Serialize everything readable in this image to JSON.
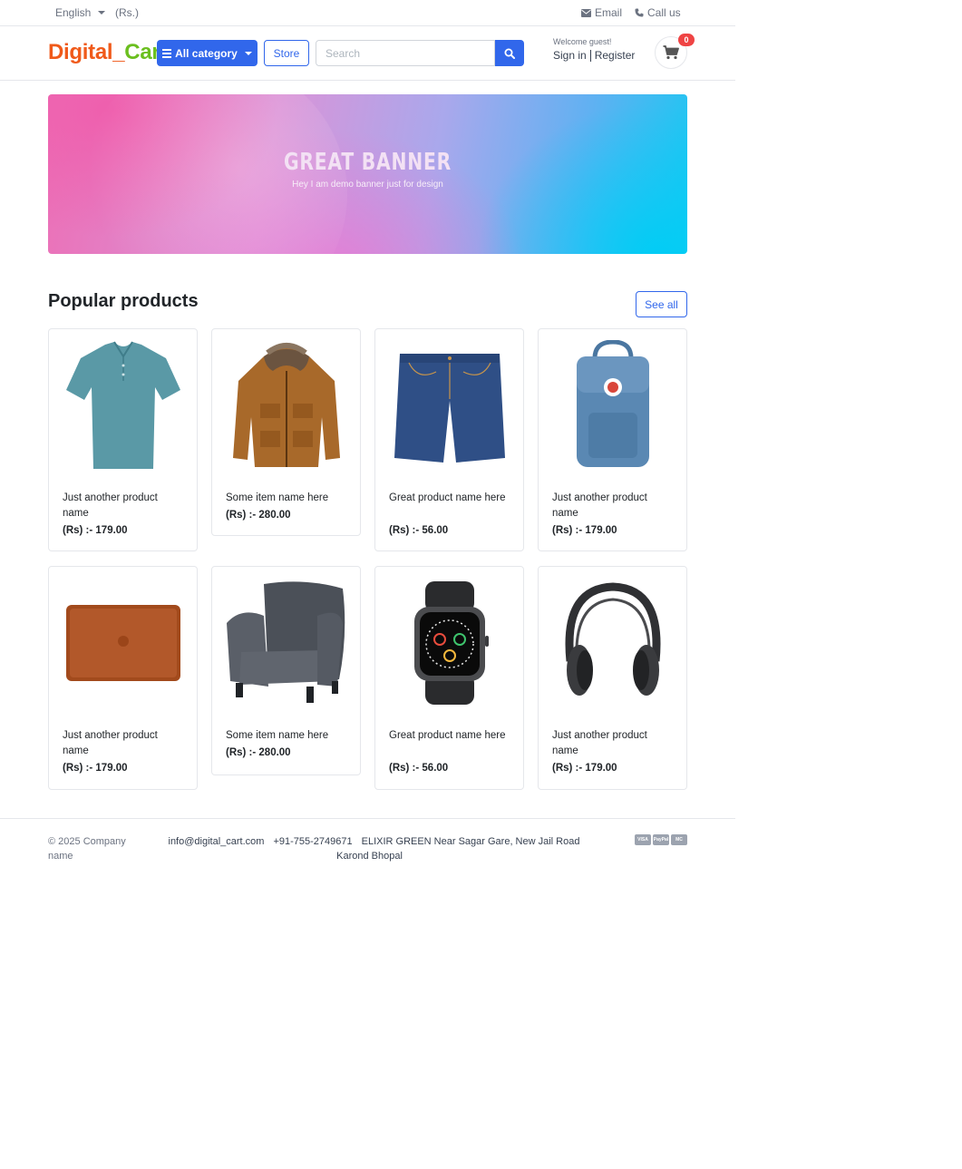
{
  "topbar": {
    "language": "English",
    "currency": "(Rs.)",
    "email_label": "Email",
    "call_label": "Call us"
  },
  "header": {
    "logo_part1": "Digital_",
    "logo_part2": "Cart",
    "category_button": "All category",
    "store_button": "Store",
    "search_placeholder": "Search",
    "welcome": "Welcome guest!",
    "sign_in": "Sign in",
    "register": "Register",
    "cart_count": "0"
  },
  "banner": {
    "title": "GREAT BANNER",
    "subtitle": "Hey I am demo banner just for design"
  },
  "section": {
    "title": "Popular products",
    "see_all": "See all"
  },
  "products": [
    {
      "name": "Just another product name",
      "price": "(Rs) :- 179.00",
      "image": "teal-polo-shirt"
    },
    {
      "name": "Some item name here",
      "price": "(Rs) :- 280.00",
      "image": "brown-winter-jacket"
    },
    {
      "name": "Great product name here",
      "price": "(Rs) :- 56.00",
      "image": "denim-shorts"
    },
    {
      "name": "Just another product name",
      "price": "(Rs) :- 179.00",
      "image": "blue-backpack"
    },
    {
      "name": "Just another product name",
      "price": "(Rs) :- 179.00",
      "image": "leather-laptop-sleeve"
    },
    {
      "name": "Some item name here",
      "price": "(Rs) :- 280.00",
      "image": "grey-armchair"
    },
    {
      "name": "Great product name here",
      "price": "(Rs) :- 56.00",
      "image": "smartwatch"
    },
    {
      "name": "Just another product name",
      "price": "(Rs) :- 179.00",
      "image": "headphones"
    }
  ],
  "footer": {
    "copyright": "© 2025 Company name",
    "email": "info@digital_cart.com",
    "phone": "+91-755-2749671",
    "address": "ELIXIR GREEN Near Sagar Gare, New Jail Road Karond Bhopal",
    "payments": [
      "VISA",
      "PayPal",
      "MC"
    ]
  },
  "colors": {
    "primary": "#3167eb",
    "logo_orange": "#f05a1a",
    "logo_green": "#6bbf1f",
    "badge_red": "#ef4444"
  }
}
